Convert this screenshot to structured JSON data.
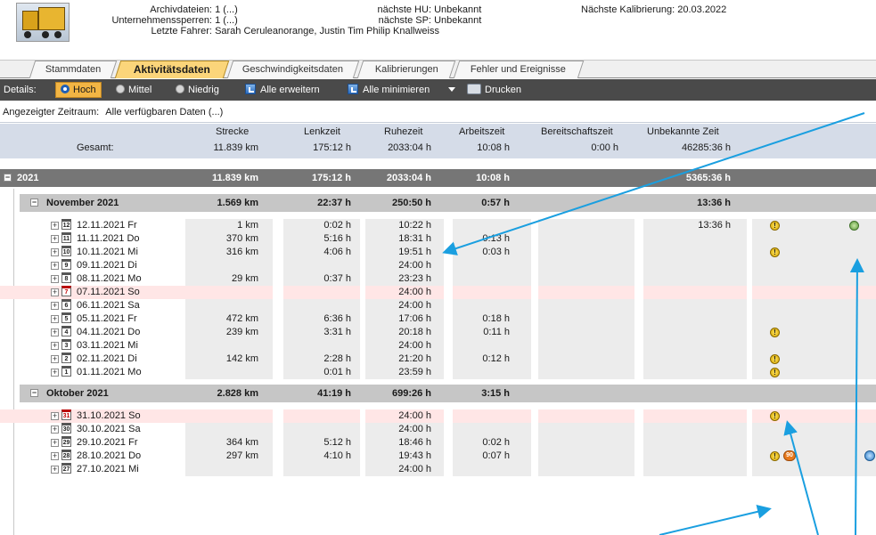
{
  "header": {
    "archiv_label": "Archivdateien:",
    "archiv_value": "1 (...)",
    "sperren_label": "Unternehmenssperren:",
    "sperren_value": "1 (...)",
    "fahrer_label": "Letzte Fahrer:",
    "fahrer_value": "Sarah Ceruleanorange, Justin Tim Philip Knallweiss",
    "hu_label": "nächste HU:",
    "hu_value": "Unbekannt",
    "sp_label": "nächste SP:",
    "sp_value": "Unbekannt",
    "kalib_label": "Nächste Kalibrierung:",
    "kalib_value": "20.03.2022"
  },
  "tabs": [
    {
      "label": "Stammdaten"
    },
    {
      "label": "Aktivitätsdaten"
    },
    {
      "label": "Geschwindigkeitsdaten"
    },
    {
      "label": "Kalibrierungen"
    },
    {
      "label": "Fehler und Ereignisse"
    }
  ],
  "toolbar": {
    "details_label": "Details:",
    "hoch": "Hoch",
    "mittel": "Mittel",
    "niedrig": "Niedrig",
    "expand": "Alle erweitern",
    "minimize": "Alle minimieren",
    "print": "Drucken"
  },
  "zeitraum": {
    "label": "Angezeigter Zeitraum:",
    "value": "Alle verfügbaren Daten (...)"
  },
  "summary": {
    "headers": [
      "Strecke",
      "Lenkzeit",
      "Ruhezeit",
      "Arbeitszeit",
      "Bereitschaftszeit",
      "Unbekannte Zeit"
    ],
    "row_label": "Gesamt:",
    "values": [
      "11.839 km",
      "175:12 h",
      "2033:04 h",
      "10:08 h",
      "0:00 h",
      "46285:36 h"
    ]
  },
  "year": {
    "label": "2021",
    "values": [
      "11.839 km",
      "175:12 h",
      "2033:04 h",
      "10:08 h",
      "",
      "5365:36 h"
    ]
  },
  "months": [
    {
      "label": "November 2021",
      "values": [
        "1.569 km",
        "22:37 h",
        "250:50 h",
        "0:57 h",
        "",
        "13:36 h"
      ],
      "days": [
        {
          "date": "12.11.2021 Fr",
          "cal": "12",
          "strecke": "1 km",
          "lenk": "0:02 h",
          "ruhe": "10:22 h",
          "arbeit": "",
          "unbekannt": "13:36 h",
          "warn": true,
          "green": true,
          "red": false
        },
        {
          "date": "11.11.2021 Do",
          "cal": "11",
          "strecke": "370 km",
          "lenk": "5:16 h",
          "ruhe": "18:31 h",
          "arbeit": "0:13 h",
          "unbekannt": "",
          "warn": false,
          "green": false,
          "red": false
        },
        {
          "date": "10.11.2021 Mi",
          "cal": "10",
          "strecke": "316 km",
          "lenk": "4:06 h",
          "ruhe": "19:51 h",
          "arbeit": "0:03 h",
          "unbekannt": "",
          "warn": true,
          "green": false,
          "red": false
        },
        {
          "date": "09.11.2021 Di",
          "cal": "9",
          "strecke": "",
          "lenk": "",
          "ruhe": "24:00 h",
          "arbeit": "",
          "unbekannt": "",
          "warn": false,
          "green": false,
          "red": false
        },
        {
          "date": "08.11.2021 Mo",
          "cal": "8",
          "strecke": "29 km",
          "lenk": "0:37 h",
          "ruhe": "23:23 h",
          "arbeit": "",
          "unbekannt": "",
          "warn": false,
          "green": false,
          "red": false
        },
        {
          "date": "07.11.2021 So",
          "cal": "7",
          "strecke": "",
          "lenk": "",
          "ruhe": "24:00 h",
          "arbeit": "",
          "unbekannt": "",
          "warn": false,
          "green": false,
          "red": true
        },
        {
          "date": "06.11.2021 Sa",
          "cal": "6",
          "strecke": "",
          "lenk": "",
          "ruhe": "24:00 h",
          "arbeit": "",
          "unbekannt": "",
          "warn": false,
          "green": false,
          "red": false
        },
        {
          "date": "05.11.2021 Fr",
          "cal": "5",
          "strecke": "472 km",
          "lenk": "6:36 h",
          "ruhe": "17:06 h",
          "arbeit": "0:18 h",
          "unbekannt": "",
          "warn": false,
          "green": false,
          "red": false
        },
        {
          "date": "04.11.2021 Do",
          "cal": "4",
          "strecke": "239 km",
          "lenk": "3:31 h",
          "ruhe": "20:18 h",
          "arbeit": "0:11 h",
          "unbekannt": "",
          "warn": true,
          "green": false,
          "red": false
        },
        {
          "date": "03.11.2021 Mi",
          "cal": "3",
          "strecke": "",
          "lenk": "",
          "ruhe": "24:00 h",
          "arbeit": "",
          "unbekannt": "",
          "warn": false,
          "green": false,
          "red": false
        },
        {
          "date": "02.11.2021 Di",
          "cal": "2",
          "strecke": "142 km",
          "lenk": "2:28 h",
          "ruhe": "21:20 h",
          "arbeit": "0:12 h",
          "unbekannt": "",
          "warn": true,
          "green": false,
          "red": false
        },
        {
          "date": "01.11.2021 Mo",
          "cal": "1",
          "strecke": "",
          "lenk": "0:01 h",
          "ruhe": "23:59 h",
          "arbeit": "",
          "unbekannt": "",
          "warn": true,
          "green": false,
          "red": false
        }
      ]
    },
    {
      "label": "Oktober 2021",
      "values": [
        "2.828 km",
        "41:19 h",
        "699:26 h",
        "3:15 h",
        "",
        ""
      ],
      "days": [
        {
          "date": "31.10.2021 So",
          "cal": "31",
          "strecke": "",
          "lenk": "",
          "ruhe": "24:00 h",
          "arbeit": "",
          "unbekannt": "",
          "warn": true,
          "green": false,
          "red": true
        },
        {
          "date": "30.10.2021 Sa",
          "cal": "30",
          "strecke": "",
          "lenk": "",
          "ruhe": "24:00 h",
          "arbeit": "",
          "unbekannt": "",
          "warn": false,
          "green": false,
          "red": false
        },
        {
          "date": "29.10.2021 Fr",
          "cal": "29",
          "strecke": "364 km",
          "lenk": "5:12 h",
          "ruhe": "18:46 h",
          "arbeit": "0:02 h",
          "unbekannt": "",
          "warn": false,
          "green": false,
          "red": false
        },
        {
          "date": "28.10.2021 Do",
          "cal": "28",
          "strecke": "297 km",
          "lenk": "4:10 h",
          "ruhe": "19:43 h",
          "arbeit": "0:07 h",
          "unbekannt": "",
          "warn": true,
          "green": false,
          "red": false,
          "badge": "90",
          "pencil": true
        },
        {
          "date": "27.10.2021 Mi",
          "cal": "27",
          "strecke": "",
          "lenk": "",
          "ruhe": "24:00 h",
          "arbeit": "",
          "unbekannt": "",
          "warn": false,
          "green": false,
          "red": false
        }
      ]
    }
  ],
  "colors": {
    "year_bar": "#767676",
    "month_bar": "#c6c6c6",
    "summary_bg": "#d5dce8",
    "toolbar_bg": "#4a4a4a",
    "active_tab": "#fbd57a",
    "hoch_button": "#f2b544",
    "weekend_row": "#ffe6e6",
    "annotation": "#1a9fe0"
  }
}
